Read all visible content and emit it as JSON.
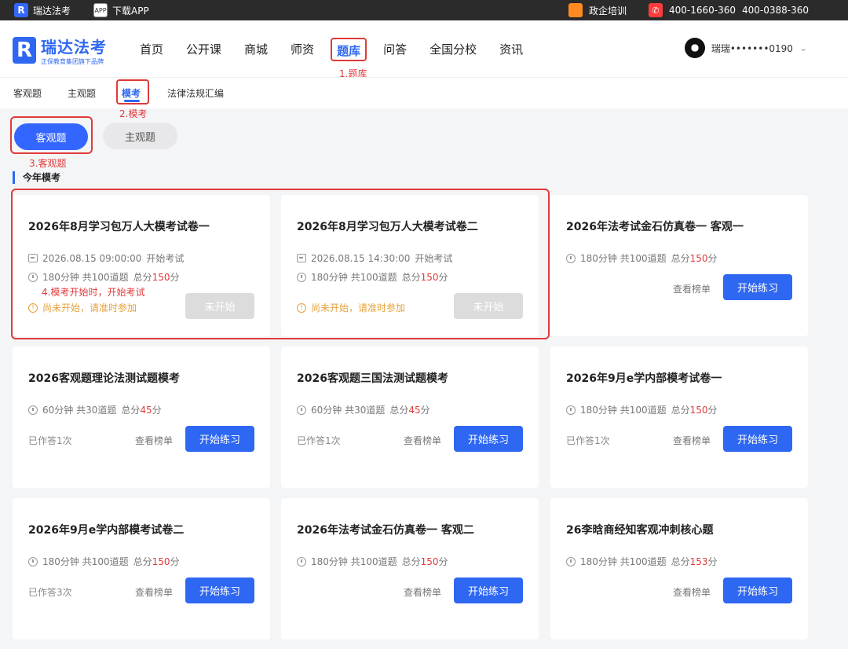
{
  "topbar": {
    "brand": "瑞达法考",
    "download": "下载APP",
    "corp_training": "政企培训",
    "phone1": "400-1660-360",
    "phone2": "400-0388-360"
  },
  "header": {
    "logo_title": "瑞达法考",
    "logo_sub": "正保教育集团旗下品牌",
    "nav": [
      "首页",
      "公开课",
      "商城",
      "师资",
      "题库",
      "问答",
      "全国分校",
      "资讯"
    ],
    "user_name": "瑞瑞•••••••0190"
  },
  "annotations": {
    "a1": "1.题库",
    "a2": "2.模考",
    "a3": "3.客观题",
    "a4": "4.模考开始时，开始考试"
  },
  "subtabs": [
    "客观题",
    "主观题",
    "模考",
    "法律法规汇编"
  ],
  "filters": {
    "primary": "客观题",
    "secondary": "主观题"
  },
  "section_title": "今年模考",
  "labels": {
    "start_practice": "开始练习",
    "not_started": "未开始",
    "rank": "查看榜单",
    "score_prefix": "总分",
    "score_suffix": "分",
    "start_exam_suffix": "开始考试",
    "notice": "尚未开始，请准时参加"
  },
  "cards": [
    {
      "title": "2026年8月学习包万人大模考试卷一",
      "date": "2026.08.15 09:00:00",
      "meta": "180分钟 共100道题",
      "score": "150"
    },
    {
      "title": "2026年8月学习包万人大模考试卷二",
      "date": "2026.08.15 14:30:00",
      "meta": "180分钟 共100道题",
      "score": "150"
    },
    {
      "title": "2026年法考试金石仿真卷一 客观一",
      "meta": "180分钟 共100道题",
      "score": "150"
    },
    {
      "title": "2026客观题理论法测试题模考",
      "meta": "60分钟 共30道题",
      "score": "45",
      "done": "已作答1次"
    },
    {
      "title": "2026客观题三国法测试题模考",
      "meta": "60分钟 共30道题",
      "score": "45",
      "done": "已作答1次"
    },
    {
      "title": "2026年9月e学内部模考试卷一",
      "meta": "180分钟 共100道题",
      "score": "150",
      "done": "已作答1次"
    },
    {
      "title": "2026年9月e学内部模考试卷二",
      "meta": "180分钟 共100道题",
      "score": "150",
      "done": "已作答3次"
    },
    {
      "title": "2026年法考试金石仿真卷一 客观二",
      "meta": "180分钟 共100道题",
      "score": "150"
    },
    {
      "title": "26李晗商经知客观冲刺核心题",
      "meta": "180分钟 共100道题",
      "score": "153"
    }
  ]
}
